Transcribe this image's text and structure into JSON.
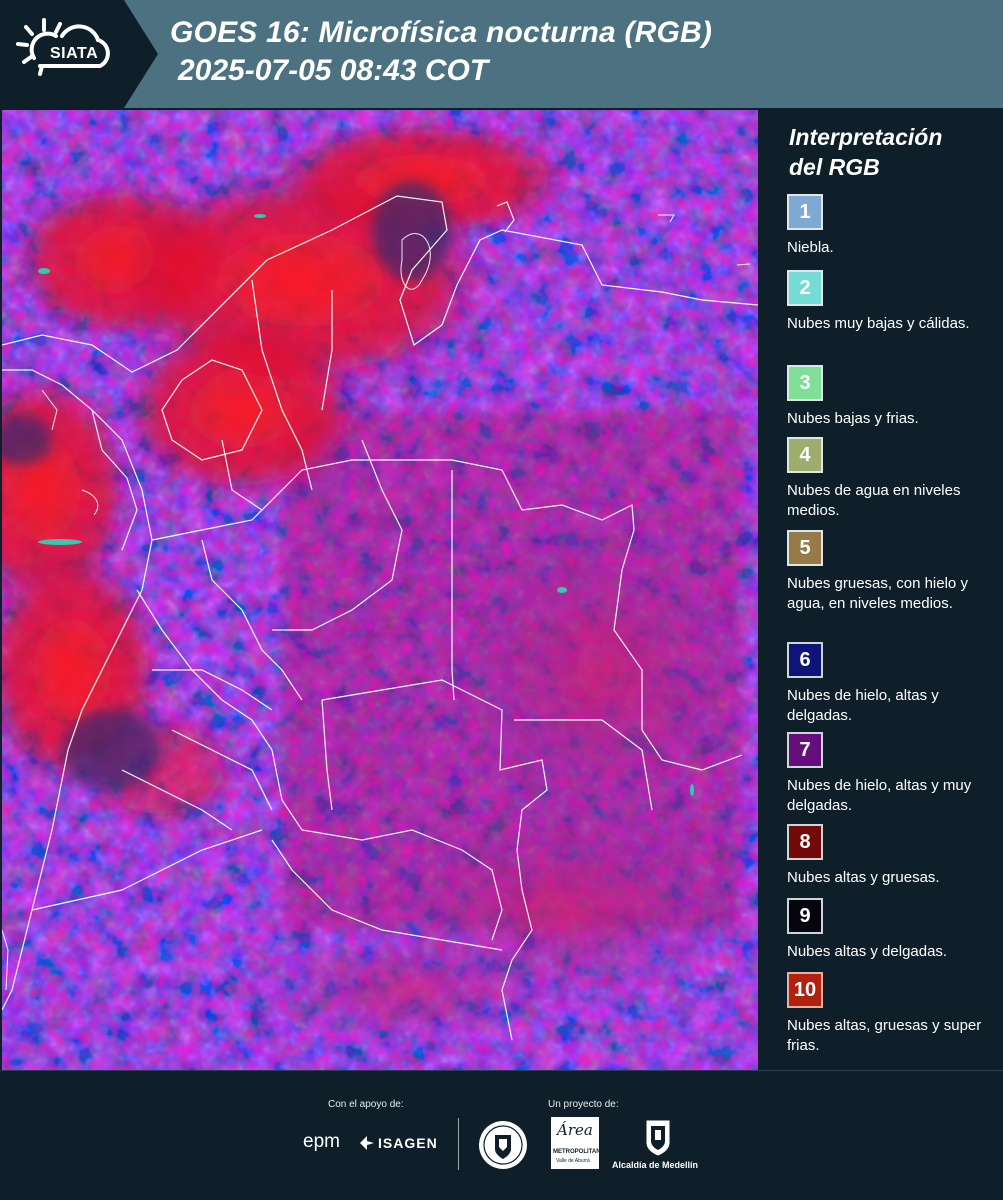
{
  "header": {
    "logo_text": "SIATA",
    "title_line1": "GOES 16: Microfísica nocturna (RGB)",
    "title_line2": "2025-07-05 08:43 COT"
  },
  "legend": {
    "title_line1": "Interpretación",
    "title_line2": "del RGB",
    "items": [
      {
        "num": "1",
        "label": "Niebla.",
        "color": "#7fa9d2"
      },
      {
        "num": "2",
        "label": "Nubes muy bajas y cálidas.",
        "color": "#74dcd4"
      },
      {
        "num": "3",
        "label": "Nubes bajas y frias.",
        "color": "#7fe095"
      },
      {
        "num": "4",
        "label": "Nubes de agua en niveles medios.",
        "color": "#9cad6c"
      },
      {
        "num": "5",
        "label": "Nubes gruesas, con hielo y agua, en niveles medios.",
        "color": "#967a47"
      },
      {
        "num": "6",
        "label": "Nubes de hielo, altas y delgadas.",
        "color": "#0e1478"
      },
      {
        "num": "7",
        "label": "Nubes de hielo, altas y muy delgadas.",
        "color": "#640f7c"
      },
      {
        "num": "8",
        "label": "Nubes altas y gruesas.",
        "color": "#720a0a"
      },
      {
        "num": "9",
        "label": "Nubes altas y delgadas.",
        "color": "#05050f"
      },
      {
        "num": "10",
        "label": "Nubes altas, gruesas y super frias.",
        "color": "#b2200e"
      }
    ]
  },
  "footer": {
    "support_label": "Con el apoyo de:",
    "project_label": "Un proyecto de:",
    "sponsor_epm": "epm",
    "sponsor_isagen": "ISAGEN",
    "partner_area": "Área",
    "partner_area_sub": "METROPOLITANA",
    "partner_area_sub2": "Valle de Aburrá",
    "partner_alcaldia": "Alcaldía de Medellín"
  }
}
